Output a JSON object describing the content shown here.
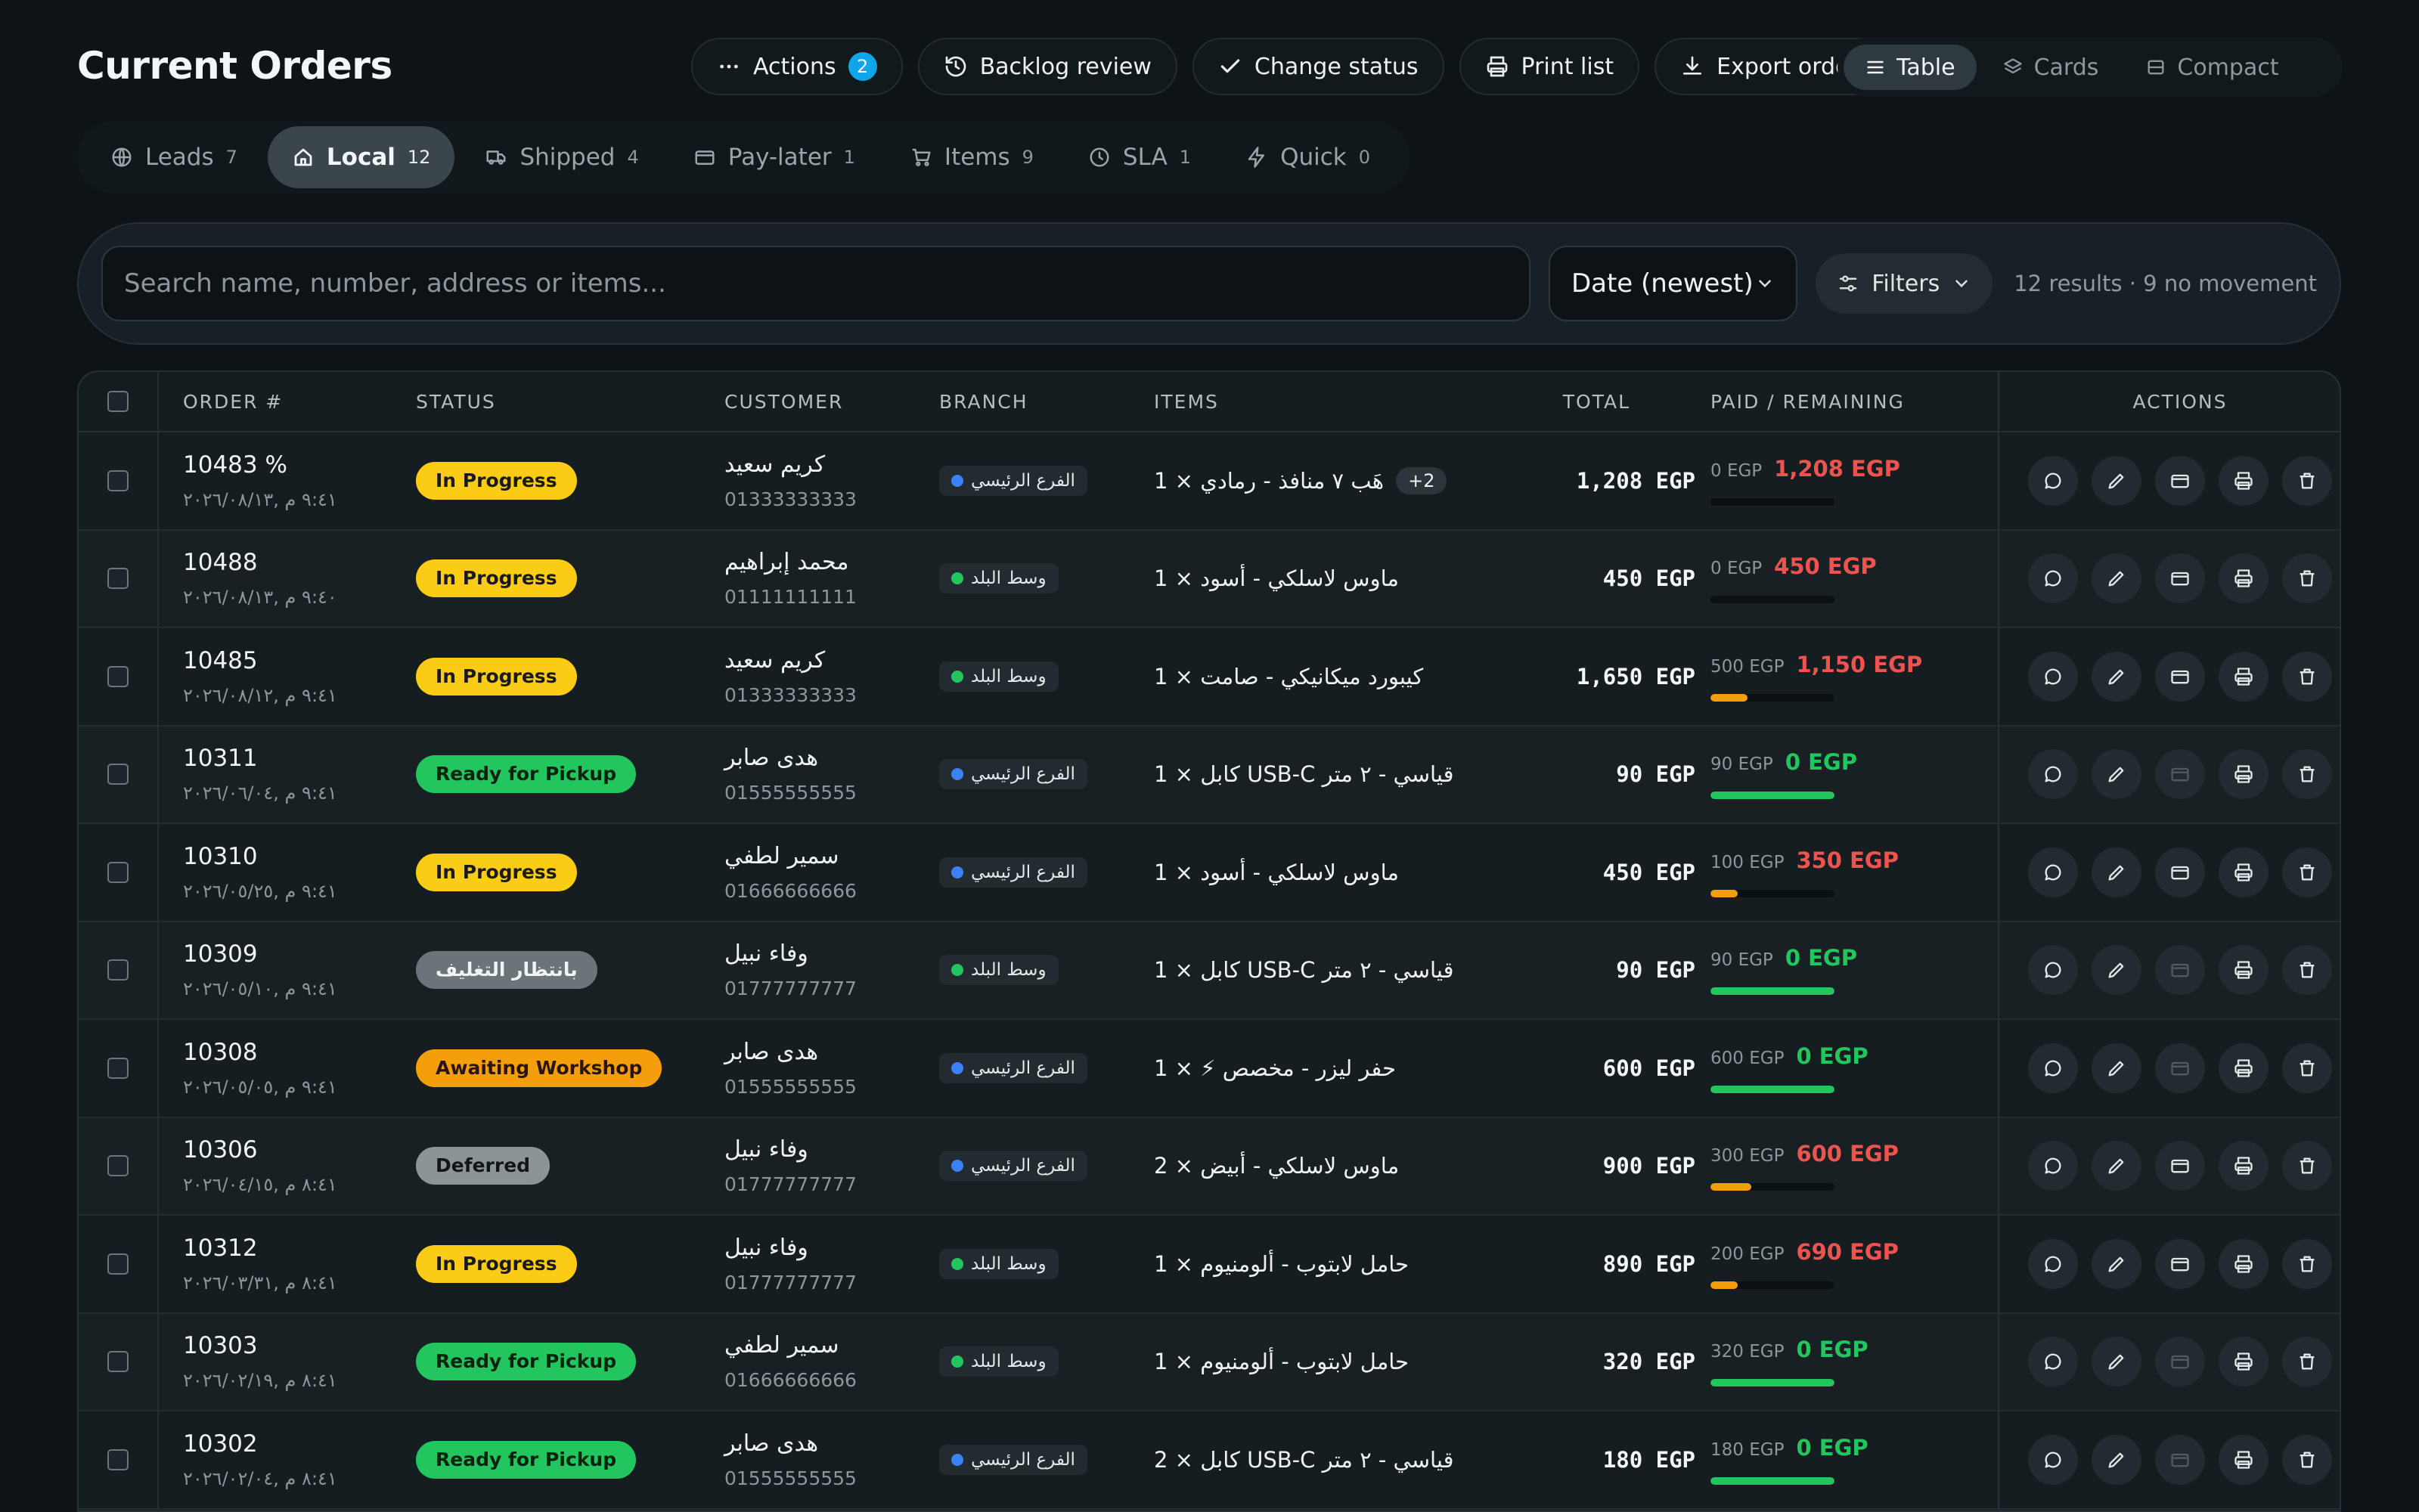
{
  "page": {
    "title": "Current Orders"
  },
  "toolbar": {
    "actions": {
      "label": "Actions",
      "badge": "2",
      "icon": "more-dots-icon"
    },
    "backlog": {
      "label": "Backlog review",
      "icon": "history-icon"
    },
    "change_status": {
      "label": "Change status",
      "icon": "check-icon"
    },
    "print_list": {
      "label": "Print list",
      "icon": "printer-icon"
    },
    "export_orders": {
      "label": "Export orders",
      "icon": "download-icon"
    }
  },
  "views": [
    {
      "label": "Table",
      "active": true,
      "icon": "table-icon"
    },
    {
      "label": "Cards",
      "active": false,
      "icon": "layers-icon"
    },
    {
      "label": "Compact",
      "active": false,
      "icon": "compact-icon"
    }
  ],
  "tabs": [
    {
      "label": "Leads",
      "count": "7",
      "icon": "globe-icon"
    },
    {
      "label": "Local",
      "count": "12",
      "icon": "home-icon",
      "active": true
    },
    {
      "label": "Shipped",
      "count": "4",
      "icon": "truck-icon"
    },
    {
      "label": "Pay-later",
      "count": "1",
      "icon": "wallet-icon"
    },
    {
      "label": "Items",
      "count": "9",
      "icon": "cart-icon"
    },
    {
      "label": "SLA",
      "count": "1",
      "icon": "clock-icon"
    },
    {
      "label": "Quick",
      "count": "0",
      "icon": "bolt-icon"
    }
  ],
  "search": {
    "placeholder": "Search name, number, address or items..."
  },
  "sort": {
    "value": "Date (newest)"
  },
  "filters": {
    "label": "Filters"
  },
  "results": "12 results · 9 no movement",
  "columns": {
    "order": "ORDER #",
    "status": "STATUS",
    "customer": "CUSTOMER",
    "branch": "BRANCH",
    "items": "ITEMS",
    "total": "TOTAL",
    "paid": "PAID / REMAINING",
    "actions": "ACTIONS"
  },
  "status_colors": {
    "In Progress": {
      "bg": "#facc15",
      "fg": "#1a1a1a"
    },
    "Ready for Pickup": {
      "bg": "#22c55e",
      "fg": "#08240f"
    },
    "بانتظار التغليف": {
      "bg": "#6b7478",
      "fg": "#f1f4f6"
    },
    "Awaiting Workshop": {
      "bg": "#f59e0b",
      "fg": "#2a1600"
    },
    "Deferred": {
      "bg": "#8d9498",
      "fg": "#121618"
    }
  },
  "branch_colors": {
    "الفرع الرئيسي": "#3b82f6",
    "وسط البلد": "#22c55e"
  },
  "orders": [
    {
      "number": "10483 %",
      "date": "٩:٤١ م ,٢٠٢٦/٠٨/١٣",
      "status": "In Progress",
      "customer": "كريم سعيد",
      "phone": "01333333333",
      "branch": "الفرع الرئيسي",
      "items": "1 × هَب ٧ منافذ - رمادي",
      "more": "+2",
      "total": "1,208 EGP",
      "paid": "0 EGP",
      "remaining": "1,208 EGP",
      "remaining_color": "#ef5350",
      "progress": 0.0,
      "bar_color": "#f59e0b",
      "wallet_enabled": true
    },
    {
      "number": "10488",
      "date": "٩:٤٠ م ,٢٠٢٦/٠٨/١٣",
      "status": "In Progress",
      "customer": "محمد إبراهيم",
      "phone": "01111111111",
      "branch": "وسط البلد",
      "items": "1 × ماوس لاسلكي - أسود",
      "total": "450 EGP",
      "paid": "0 EGP",
      "remaining": "450 EGP",
      "remaining_color": "#ef5350",
      "progress": 0.0,
      "bar_color": "#f59e0b",
      "wallet_enabled": true
    },
    {
      "number": "10485",
      "date": "٩:٤١ م ,٢٠٢٦/٠٨/١٢",
      "status": "In Progress",
      "customer": "كريم سعيد",
      "phone": "01333333333",
      "branch": "وسط البلد",
      "items": "1 × كيبورد ميكانيكي - صامت",
      "total": "1,650 EGP",
      "paid": "500 EGP",
      "remaining": "1,150 EGP",
      "remaining_color": "#ef5350",
      "progress": 0.3,
      "bar_color": "#f59e0b",
      "wallet_enabled": true
    },
    {
      "number": "10311",
      "date": "٩:٤١ م ,٢٠٢٦/٠٦/٠٤",
      "status": "Ready for Pickup",
      "customer": "هدى صابر",
      "phone": "01555555555",
      "branch": "الفرع الرئيسي",
      "items": "1 × كابل USB-C قياسي - ٢ متر",
      "total": "90 EGP",
      "paid": "90 EGP",
      "remaining": "0 EGP",
      "remaining_color": "#22c55e",
      "progress": 1.0,
      "bar_color": "#22c55e",
      "wallet_enabled": false
    },
    {
      "number": "10310",
      "date": "٩:٤١ م ,٢٠٢٦/٠٥/٢٥",
      "status": "In Progress",
      "customer": "سمير لطفي",
      "phone": "01666666666",
      "branch": "الفرع الرئيسي",
      "items": "1 × ماوس لاسلكي - أسود",
      "total": "450 EGP",
      "paid": "100 EGP",
      "remaining": "350 EGP",
      "remaining_color": "#ef5350",
      "progress": 0.22,
      "bar_color": "#f59e0b",
      "wallet_enabled": true
    },
    {
      "number": "10309",
      "date": "٩:٤١ م ,٢٠٢٦/٠٥/١٠",
      "status": "بانتظار التغليف",
      "customer": "وفاء نبيل",
      "phone": "01777777777",
      "branch": "وسط البلد",
      "items": "1 × كابل USB-C قياسي - ٢ متر",
      "total": "90 EGP",
      "paid": "90 EGP",
      "remaining": "0 EGP",
      "remaining_color": "#22c55e",
      "progress": 1.0,
      "bar_color": "#22c55e",
      "wallet_enabled": false
    },
    {
      "number": "10308",
      "date": "٩:٤١ م ,٢٠٢٦/٠٥/٠٥",
      "status": "Awaiting Workshop",
      "customer": "هدى صابر",
      "phone": "01555555555",
      "branch": "الفرع الرئيسي",
      "items": "1 × ⚡ حفر ليزر - مخصص",
      "total": "600 EGP",
      "paid": "600 EGP",
      "remaining": "0 EGP",
      "remaining_color": "#22c55e",
      "progress": 1.0,
      "bar_color": "#22c55e",
      "wallet_enabled": false
    },
    {
      "number": "10306",
      "date": "٨:٤١ م ,٢٠٢٦/٠٤/١٥",
      "status": "Deferred",
      "customer": "وفاء نبيل",
      "phone": "01777777777",
      "branch": "الفرع الرئيسي",
      "items": "2 × ماوس لاسلكي - أبيض",
      "total": "900 EGP",
      "paid": "300 EGP",
      "remaining": "600 EGP",
      "remaining_color": "#ef5350",
      "progress": 0.33,
      "bar_color": "#f59e0b",
      "wallet_enabled": true
    },
    {
      "number": "10312",
      "date": "٨:٤١ م ,٢٠٢٦/٠٣/٣١",
      "status": "In Progress",
      "customer": "وفاء نبيل",
      "phone": "01777777777",
      "branch": "وسط البلد",
      "items": "1 × حامل لابتوب - ألومنيوم",
      "total": "890 EGP",
      "paid": "200 EGP",
      "remaining": "690 EGP",
      "remaining_color": "#ef5350",
      "progress": 0.22,
      "bar_color": "#f59e0b",
      "wallet_enabled": true
    },
    {
      "number": "10303",
      "date": "٨:٤١ م ,٢٠٢٦/٠٢/١٩",
      "status": "Ready for Pickup",
      "customer": "سمير لطفي",
      "phone": "01666666666",
      "branch": "وسط البلد",
      "items": "1 × حامل لابتوب - ألومنيوم",
      "total": "320 EGP",
      "paid": "320 EGP",
      "remaining": "0 EGP",
      "remaining_color": "#22c55e",
      "progress": 1.0,
      "bar_color": "#22c55e",
      "wallet_enabled": false
    },
    {
      "number": "10302",
      "date": "٨:٤١ م ,٢٠٢٦/٠٢/٠٤",
      "status": "Ready for Pickup",
      "customer": "هدى صابر",
      "phone": "01555555555",
      "branch": "الفرع الرئيسي",
      "items": "2 × كابل USB-C قياسي - ٢ متر",
      "total": "180 EGP",
      "paid": "180 EGP",
      "remaining": "0 EGP",
      "remaining_color": "#22c55e",
      "progress": 1.0,
      "bar_color": "#22c55e",
      "wallet_enabled": false
    }
  ]
}
